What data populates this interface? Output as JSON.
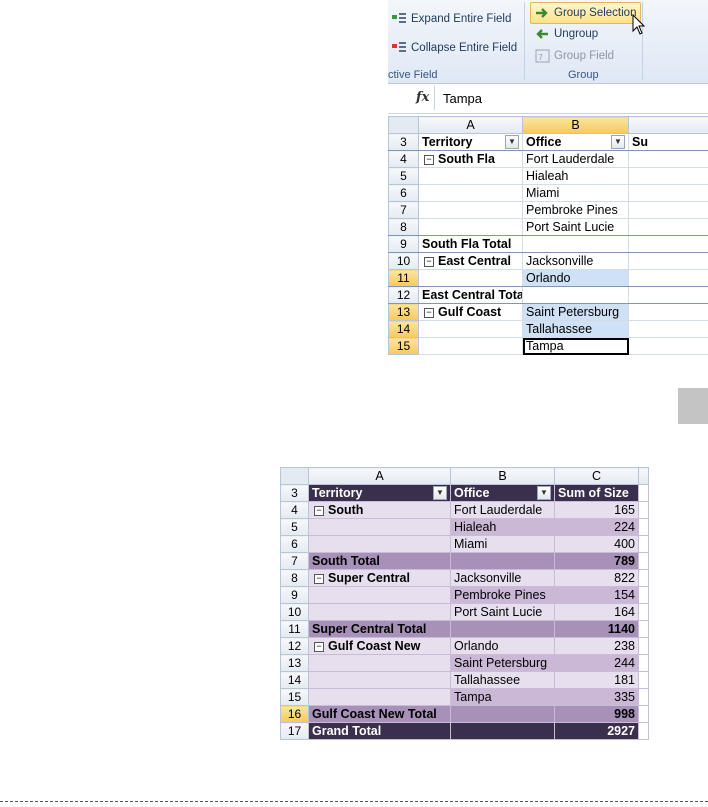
{
  "ribbon": {
    "expand_label": "Expand Entire Field",
    "collapse_label": "Collapse Entire Field",
    "active_field_label": "ctive Field",
    "group_selection_label": "Group Selection",
    "ungroup_label": "Ungroup",
    "group_field_label": "Group Field",
    "group_label": "Group",
    "accent_highlight": "#ffe38a"
  },
  "formula_bar": {
    "fx": "fx",
    "value": "Tampa"
  },
  "grid_top": {
    "columns": [
      "A",
      "B"
    ],
    "rows": [
      {
        "n": "3",
        "a": "Territory",
        "b": "Office",
        "c": "Su"
      },
      {
        "n": "4",
        "a": "South Fla",
        "b": "Fort Lauderdale"
      },
      {
        "n": "5",
        "a": "",
        "b": "Hialeah"
      },
      {
        "n": "6",
        "a": "",
        "b": "Miami"
      },
      {
        "n": "7",
        "a": "",
        "b": "Pembroke Pines"
      },
      {
        "n": "8",
        "a": "",
        "b": "Port Saint Lucie"
      },
      {
        "n": "9",
        "a": "South Fla Total",
        "b": ""
      },
      {
        "n": "10",
        "a": "East Central",
        "b": "Jacksonville"
      },
      {
        "n": "11",
        "a": "",
        "b": "Orlando"
      },
      {
        "n": "12",
        "a": "East Central Total",
        "b": ""
      },
      {
        "n": "13",
        "a": "Gulf Coast",
        "b": "Saint Petersburg"
      },
      {
        "n": "14",
        "a": "",
        "b": "Tallahassee"
      },
      {
        "n": "15",
        "a": "",
        "b": "Tampa"
      }
    ]
  },
  "grid_bottom": {
    "columns": [
      "A",
      "B",
      "C"
    ],
    "header": {
      "n": "3",
      "a": "Territory",
      "b": "Office",
      "c": "Sum of Size"
    },
    "rows": [
      {
        "n": "4",
        "a": "South",
        "b": "Fort Lauderdale",
        "c": "165"
      },
      {
        "n": "5",
        "a": "",
        "b": "Hialeah",
        "c": "224"
      },
      {
        "n": "6",
        "a": "",
        "b": "Miami",
        "c": "400"
      },
      {
        "n": "7",
        "a": "South Total",
        "b": "",
        "c": "789"
      },
      {
        "n": "8",
        "a": "Super Central",
        "b": "Jacksonville",
        "c": "822"
      },
      {
        "n": "9",
        "a": "",
        "b": "Pembroke Pines",
        "c": "154"
      },
      {
        "n": "10",
        "a": "",
        "b": "Port Saint Lucie",
        "c": "164"
      },
      {
        "n": "11",
        "a": "Super Central Total",
        "b": "",
        "c": "1140"
      },
      {
        "n": "12",
        "a": "Gulf Coast New",
        "b": "Orlando",
        "c": "238"
      },
      {
        "n": "13",
        "a": "",
        "b": "Saint Petersburg",
        "c": "244"
      },
      {
        "n": "14",
        "a": "",
        "b": "Tallahassee",
        "c": "181"
      },
      {
        "n": "15",
        "a": "",
        "b": "Tampa",
        "c": "335"
      },
      {
        "n": "16",
        "a": "Gulf Coast New Total",
        "b": "",
        "c": "998"
      },
      {
        "n": "17",
        "a": "Grand Total",
        "b": "",
        "c": "2927"
      }
    ],
    "colors": {
      "dark": "#3b2f4e",
      "light": "#e8dfee",
      "mid": "#cbb8d6",
      "total": "#a891b8"
    }
  }
}
